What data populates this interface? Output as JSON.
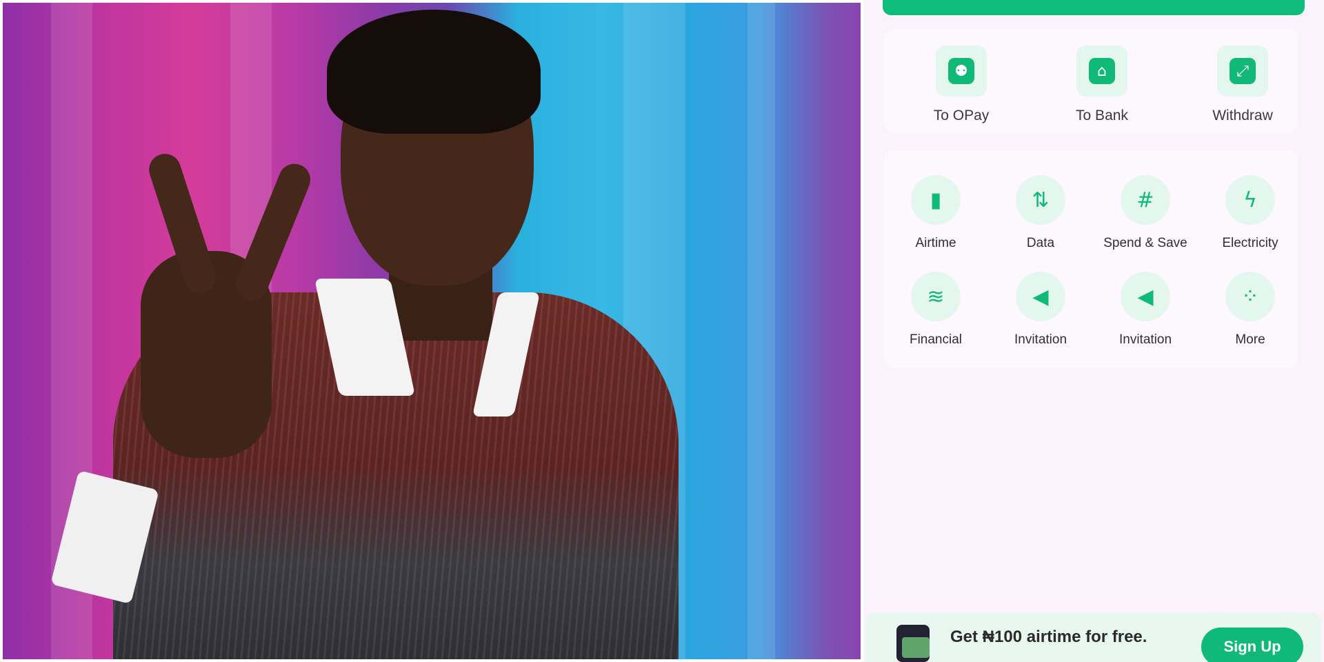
{
  "photo": {
    "alt_subject": "person"
  },
  "app": {
    "accent_color": "#10b978",
    "transfer_actions": [
      {
        "label": "To OPay",
        "icon": "person-card-icon"
      },
      {
        "label": "To Bank",
        "icon": "bank-icon"
      },
      {
        "label": "Withdraw",
        "icon": "withdraw-icon"
      }
    ],
    "services": [
      {
        "label": "Airtime",
        "icon": "phone-signal-icon"
      },
      {
        "label": "Data",
        "icon": "phone-data-icon"
      },
      {
        "label": "Spend & Save",
        "icon": "money-bag-icon"
      },
      {
        "label": "Electricity",
        "icon": "bulb-icon"
      },
      {
        "label": "Financial",
        "icon": "coins-icon"
      },
      {
        "label": "Invitation",
        "icon": "megaphone-icon"
      },
      {
        "label": "Invitation",
        "icon": "megaphone-icon"
      },
      {
        "label": "More",
        "icon": "more-grid-icon"
      }
    ],
    "promo": {
      "text": "Get ₦100 airtime for free.",
      "button_label": "Sign Up"
    }
  }
}
